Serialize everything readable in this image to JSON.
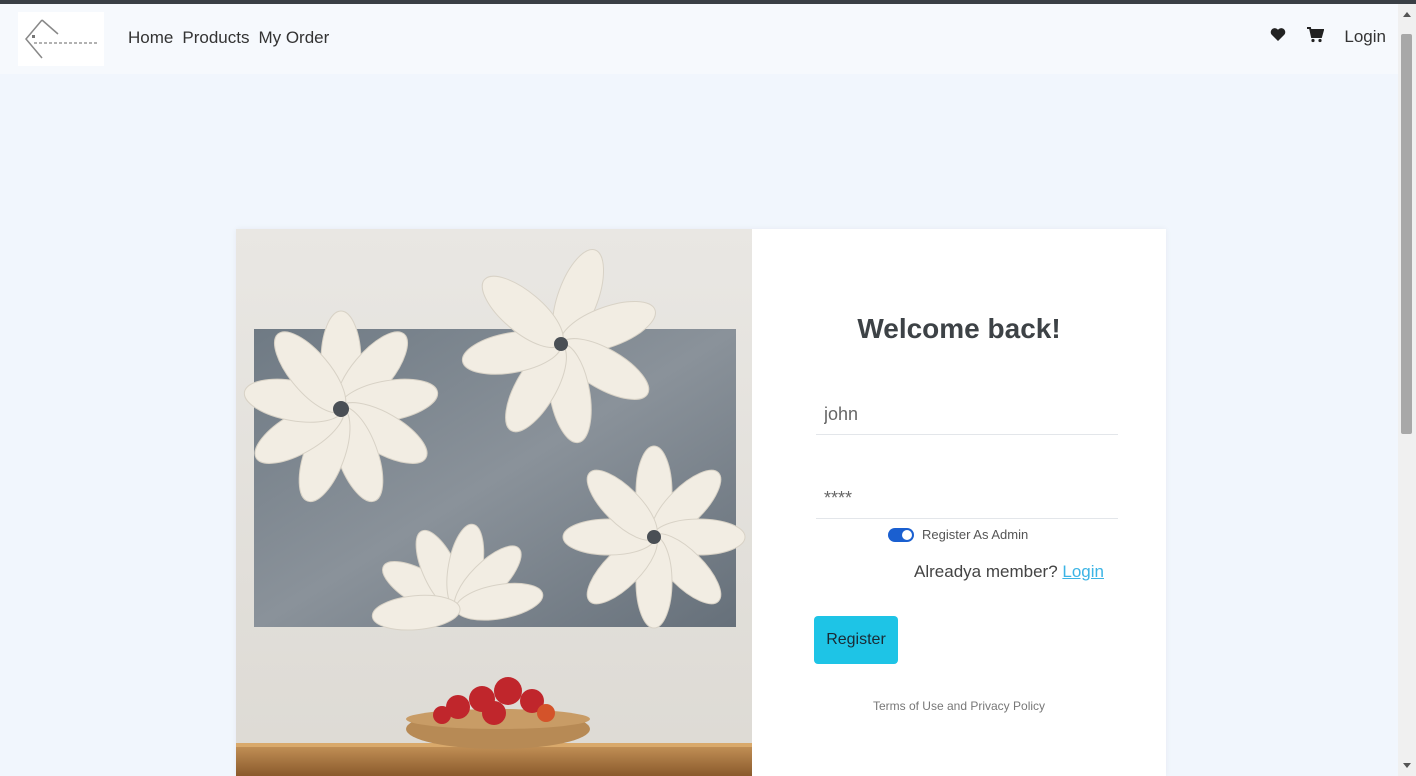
{
  "nav": {
    "links": [
      "Home",
      "Products",
      "My Order"
    ],
    "login_label": "Login",
    "icons": [
      "heart-icon",
      "cart-icon"
    ]
  },
  "form": {
    "title": "Welcome back!",
    "username_value": "john",
    "password_value": "****",
    "admin_toggle_label": "Register As Admin",
    "admin_toggle_on": true,
    "member_prompt": "Alreadya member?",
    "login_link": "Login",
    "register_button": "Register",
    "terms": "Terms of Use and Privacy Policy"
  },
  "colors": {
    "accent": "#1ec4e6",
    "link": "#3cb4e5",
    "toggle": "#1a5fd0",
    "page_bg": "#f1f6fd"
  }
}
